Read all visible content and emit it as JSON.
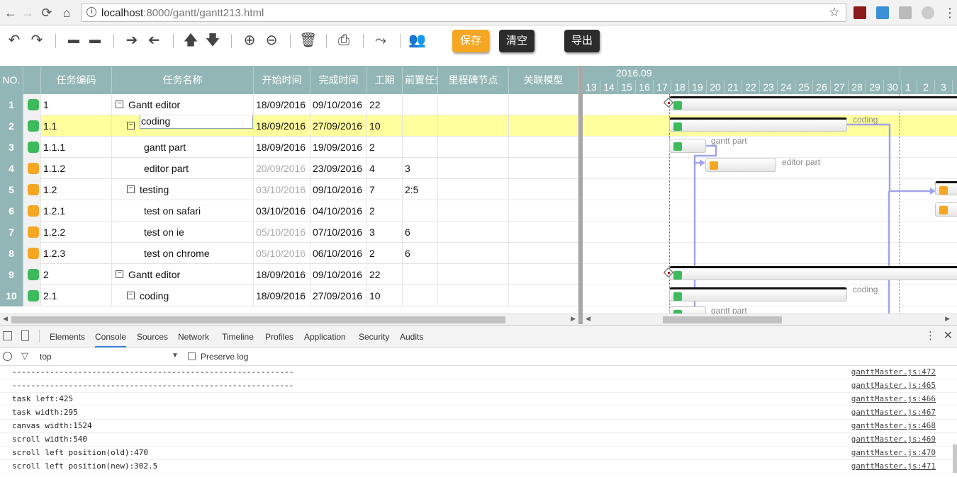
{
  "browser": {
    "url_host": "localhost",
    "url_path": ":8000/gantt/gantt213.html",
    "back": "←",
    "forward": "→",
    "reload": "⟳",
    "home": "⌂",
    "star": "☆",
    "menu": "⋮",
    "info": "i"
  },
  "toolbar": {
    "save_label": "保存",
    "clear_label": "清空",
    "export_label": "导出",
    "save_color": "#f5a623",
    "dark_color": "#2c2c2c"
  },
  "grid": {
    "headers": [
      "NO.",
      "",
      "任务编码",
      "任务名称",
      "开始时间",
      "完成时间",
      "工期",
      "前置任务",
      "里程碑节点",
      "关联模型"
    ],
    "rows": [
      {
        "no": "1",
        "status": "green",
        "code": "1",
        "name": "Gantt editor",
        "start": "18/09/2016",
        "end": "09/10/2016",
        "dur": "22",
        "pred": "",
        "toggle": "−",
        "level": 0,
        "startDim": false
      },
      {
        "no": "2",
        "status": "green",
        "code": "1.1",
        "name": "coding",
        "start": "18/09/2016",
        "end": "27/09/2016",
        "dur": "10",
        "pred": "",
        "toggle": "−",
        "level": 1,
        "startDim": false,
        "selected": true
      },
      {
        "no": "3",
        "status": "green",
        "code": "1.1.1",
        "name": "gantt part",
        "start": "18/09/2016",
        "end": "19/09/2016",
        "dur": "2",
        "pred": "",
        "toggle": "",
        "level": 2,
        "startDim": false
      },
      {
        "no": "4",
        "status": "orange",
        "code": "1.1.2",
        "name": "editor part",
        "start": "20/09/2016",
        "end": "23/09/2016",
        "dur": "4",
        "pred": "3",
        "toggle": "",
        "level": 2,
        "startDim": true
      },
      {
        "no": "5",
        "status": "orange",
        "code": "1.2",
        "name": "testing",
        "start": "03/10/2016",
        "end": "09/10/2016",
        "dur": "7",
        "pred": "2:5",
        "toggle": "−",
        "level": 1,
        "startDim": true
      },
      {
        "no": "6",
        "status": "orange",
        "code": "1.2.1",
        "name": "test on safari",
        "start": "03/10/2016",
        "end": "04/10/2016",
        "dur": "2",
        "pred": "",
        "toggle": "",
        "level": 2,
        "startDim": false
      },
      {
        "no": "7",
        "status": "orange",
        "code": "1.2.2",
        "name": "test on ie",
        "start": "05/10/2016",
        "end": "07/10/2016",
        "dur": "3",
        "pred": "6",
        "toggle": "",
        "level": 2,
        "startDim": true
      },
      {
        "no": "8",
        "status": "orange",
        "code": "1.2.3",
        "name": "test on chrome",
        "start": "05/10/2016",
        "end": "06/10/2016",
        "dur": "2",
        "pred": "6",
        "toggle": "",
        "level": 2,
        "startDim": true
      },
      {
        "no": "9",
        "status": "green",
        "code": "2",
        "name": "Gantt editor",
        "start": "18/09/2016",
        "end": "09/10/2016",
        "dur": "22",
        "pred": "",
        "toggle": "−",
        "level": 0,
        "startDim": false
      },
      {
        "no": "10",
        "status": "green",
        "code": "2.1",
        "name": "coding",
        "start": "18/09/2016",
        "end": "27/09/2016",
        "dur": "10",
        "pred": "",
        "toggle": "−",
        "level": 1,
        "startDim": false
      }
    ],
    "status_colors": {
      "green": "#3dba5b",
      "orange": "#f5a623"
    }
  },
  "gantt": {
    "month_label": "2016.09",
    "days": [
      "13",
      "14",
      "15",
      "16",
      "17",
      "18",
      "19",
      "20",
      "21",
      "22",
      "23",
      "24",
      "25",
      "26",
      "27",
      "28",
      "29",
      "30",
      "1",
      "2",
      "3"
    ],
    "labels": {
      "coding": "coding",
      "gantt_part": "gantt part",
      "editor_part": "editor part"
    }
  },
  "devtools": {
    "tabs": [
      "Elements",
      "Console",
      "Sources",
      "Network",
      "Timeline",
      "Profiles",
      "Application",
      "Security",
      "Audits"
    ],
    "active_tab": "Console",
    "context": "top",
    "preserve_log": "Preserve log",
    "logs": [
      {
        "msg": "------------------------------------------------------------",
        "src": "ganttMaster.js:472"
      },
      {
        "msg": "------------------------------------------------------------",
        "src": "ganttMaster.js:465"
      },
      {
        "msg": "task left:425",
        "src": "ganttMaster.js:466"
      },
      {
        "msg": "task width:295",
        "src": "ganttMaster.js:467"
      },
      {
        "msg": "canvas width:1524",
        "src": "ganttMaster.js:468"
      },
      {
        "msg": "scroll width:540",
        "src": "ganttMaster.js:469"
      },
      {
        "msg": "scroll left position(old):470",
        "src": "ganttMaster.js:470"
      },
      {
        "msg": "scroll left position(new):302.5",
        "src": "ganttMaster.js:471"
      }
    ]
  }
}
